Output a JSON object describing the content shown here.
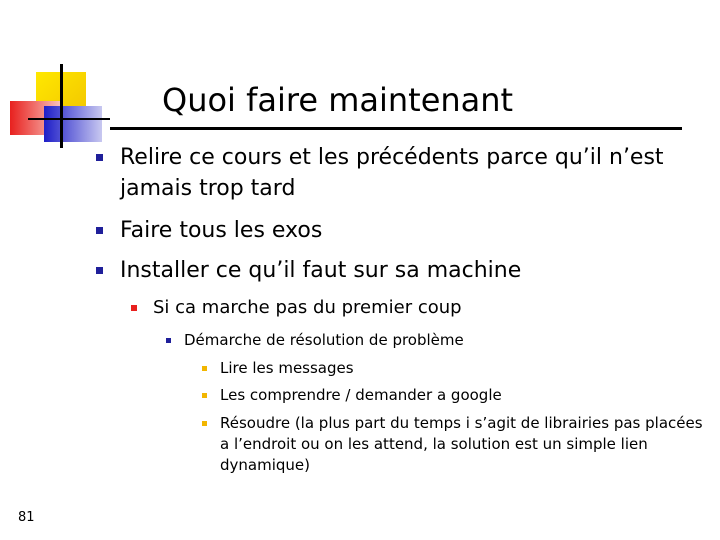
{
  "slide": {
    "title": "Quoi faire maintenant",
    "page_number": "81",
    "bullets": {
      "b1": "Relire ce cours et les précédents parce qu’il n’est jamais trop tard",
      "b2": "Faire tous les exos",
      "b3": "Installer ce qu’il faut sur sa machine",
      "b3_1": "Si ca marche pas du premier coup",
      "b3_1_1": "Démarche de résolution de problème",
      "b3_1_1_1": "Lire les messages",
      "b3_1_1_2": "Les comprendre  / demander a google",
      "b3_1_1_3": "Résoudre (la plus part du temps i s’agit de librairies pas placées a l’endroit ou on les attend, la solution est un simple lien dynamique)"
    }
  },
  "colors": {
    "bullet_l1": "#1f1f9a",
    "bullet_l2": "#e8201e",
    "bullet_l3": "#1f1f9a",
    "bullet_l4": "#f2b600",
    "logo_yellow": "#f5d800",
    "logo_red": "#e8201e",
    "logo_blue": "#2a2ad0"
  }
}
